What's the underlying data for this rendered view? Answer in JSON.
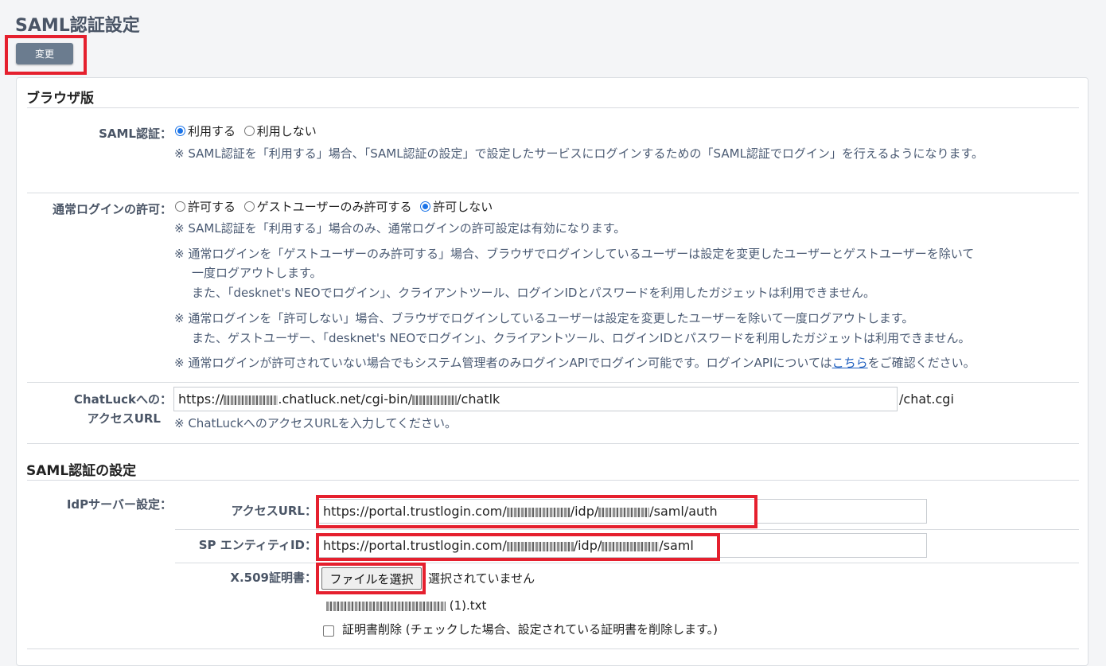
{
  "page": {
    "title": "SAML認証設定"
  },
  "toolbar": {
    "change_label": "変更"
  },
  "browser": {
    "title": "ブラウザ版",
    "saml_auth": {
      "label": "SAML認証：",
      "options": [
        "利用する",
        "利用しない"
      ],
      "selected": "利用する",
      "note": "※ SAML認証を「利用する」場合、「SAML認証の設定」で設定したサービスにログインするための「SAML認証でログイン」を行えるようになります。"
    },
    "normal_login": {
      "label": "通常ログインの許可：",
      "options": [
        "許可する",
        "ゲストユーザーのみ許可する",
        "許可しない"
      ],
      "selected": "許可しない",
      "note1": "※ SAML認証を「利用する」場合のみ、通常ログインの許可設定は有効になります。",
      "note2_line1": "※ 通常ログインを「ゲストユーザーのみ許可する」場合、ブラウザでログインしているユーザーは設定を変更したユーザーとゲストユーザーを除いて",
      "note2_line2": "一度ログアウトします。",
      "note2_line3": "また、「desknet's NEOでログイン」、クライアントツール、ログインIDとパスワードを利用したガジェットは利用できません。",
      "note3_line1": "※ 通常ログインを「許可しない」場合、ブラウザでログインしているユーザーは設定を変更したユーザーを除いて一度ログアウトします。",
      "note3_line2": "また、ゲストユーザー、「desknet's NEOでログイン」、クライアントツール、ログインIDとパスワードを利用したガジェットは利用できません。",
      "note4_prefix": "※ 通常ログインが許可されていない場合でもシステム管理者のみログインAPIでログイン可能です。ログインAPIについては",
      "note4_link": "こちら",
      "note4_suffix": "をご確認ください。"
    },
    "chatluck": {
      "label_line1": "ChatLuckへの：",
      "label_line2": "アクセスURL",
      "url_prefix": "https://",
      "url_middle": ".chatluck.net/cgi-bin/",
      "url_suffix": "/chatlk",
      "after": "/chat.cgi",
      "note": "※ ChatLuckへのアクセスURLを入力してください。"
    }
  },
  "saml_settings": {
    "title": "SAML認証の設定",
    "idp_label": "IdPサーバー設定：",
    "access_url": {
      "label": "アクセスURL：",
      "prefix": "https://portal.trustlogin.com/",
      "middle": "/idp/",
      "suffix": "/saml/auth"
    },
    "sp_entity": {
      "label": "SP エンティティID：",
      "prefix": "https://portal.trustlogin.com/",
      "middle": "/idp/",
      "suffix": "/saml"
    },
    "cert": {
      "label": "X.509証明書：",
      "button": "ファイルを選択",
      "status": "選択されていません",
      "file_suffix": "(1).txt",
      "delete_label": "証明書削除 (チェックした場合、設定されている証明書を削除します。)"
    }
  },
  "colors": {
    "highlight": "#e5202e",
    "accent": "#1a73e8",
    "button": "#6b7c8f"
  }
}
